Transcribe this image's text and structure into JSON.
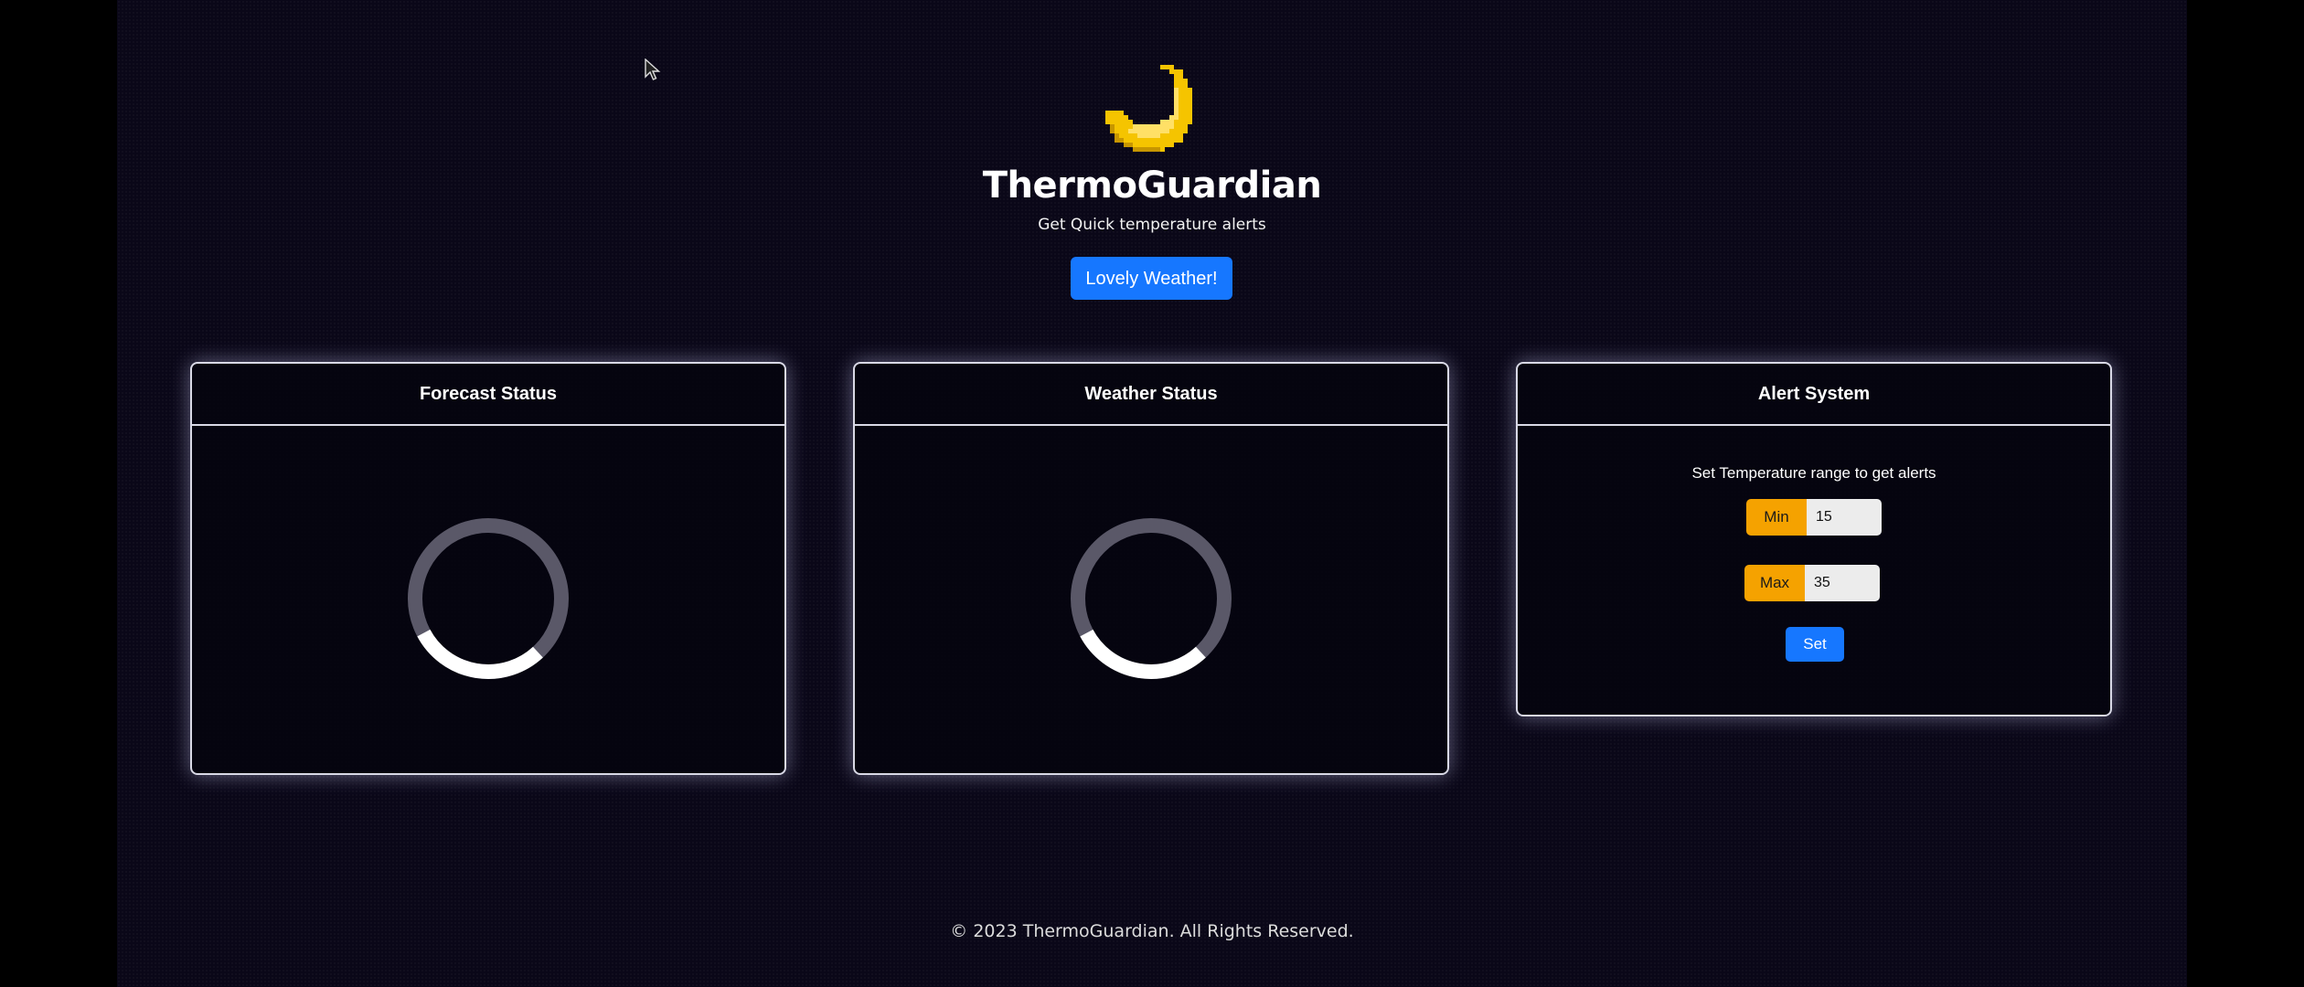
{
  "app": {
    "title": "ThermoGuardian",
    "subtitle": "Get Quick temperature alerts",
    "logo_icon": "crescent-moon-icon",
    "weather_button_label": "Lovely Weather!"
  },
  "panels": {
    "forecast": {
      "title": "Forecast Status",
      "state": "loading"
    },
    "weather": {
      "title": "Weather Status",
      "state": "loading"
    },
    "alert": {
      "title": "Alert System",
      "caption": "Set Temperature range to get alerts",
      "min_label": "Min",
      "min_value": "15",
      "max_label": "Max",
      "max_value": "35",
      "set_label": "Set"
    }
  },
  "footer": {
    "text": "© 2023 ThermoGuardian. All Rights Reserved."
  },
  "colors": {
    "background": "#0a0718",
    "accent_blue": "#1677ff",
    "accent_orange": "#f5a200",
    "moon": "#f5c400"
  }
}
